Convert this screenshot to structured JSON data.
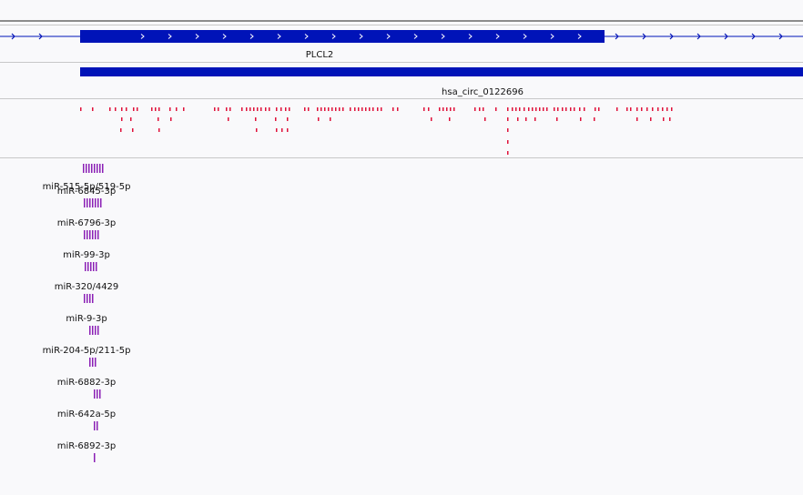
{
  "tracks": {
    "gene": {
      "name": "PLCL2",
      "color": "#0013b8"
    },
    "circrna": {
      "name": "hsa_circ_0122696",
      "color": "#0013b8"
    },
    "binding_sites": {
      "color": "#e0113a"
    }
  },
  "mirna": {
    "color": "#8a1fb5",
    "items": [
      {
        "label": "miR-515-5p/519-5p",
        "ticks": 8
      },
      {
        "label": "miR-6845-3p",
        "ticks": 7
      },
      {
        "label": "miR-6796-3p",
        "ticks": 6
      },
      {
        "label": "miR-99-3p",
        "ticks": 5
      },
      {
        "label": "miR-320/4429",
        "ticks": 4
      },
      {
        "label": "miR-9-3p",
        "ticks": 4
      },
      {
        "label": "miR-204-5p/211-5p",
        "ticks": 3
      },
      {
        "label": "miR-6882-3p",
        "ticks": 3
      },
      {
        "label": "miR-642a-5p",
        "ticks": 2
      },
      {
        "label": "miR-6892-3p",
        "ticks": 1
      }
    ]
  }
}
